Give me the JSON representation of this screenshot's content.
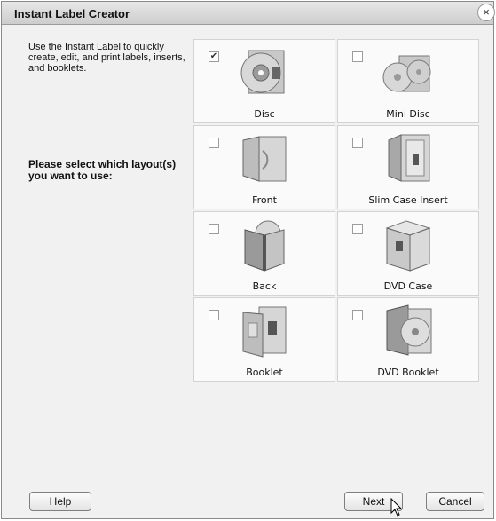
{
  "window": {
    "title": "Instant Label Creator",
    "close_glyph": "×"
  },
  "intro_text": "Use the Instant Label to quickly create, edit, and print labels, inserts, and booklets.",
  "prompt_text": "Please select which layout(s) you want to use:",
  "layouts": [
    {
      "label": "Disc",
      "checked": true,
      "icon": "disc-icon"
    },
    {
      "label": "Mini Disc",
      "checked": false,
      "icon": "mini-disc-icon"
    },
    {
      "label": "Front",
      "checked": false,
      "icon": "front-cover-icon"
    },
    {
      "label": "Slim Case Insert",
      "checked": false,
      "icon": "slim-case-insert-icon"
    },
    {
      "label": "Back",
      "checked": false,
      "icon": "back-cover-icon"
    },
    {
      "label": "DVD Case",
      "checked": false,
      "icon": "dvd-case-icon"
    },
    {
      "label": "Booklet",
      "checked": false,
      "icon": "booklet-icon"
    },
    {
      "label": "DVD Booklet",
      "checked": false,
      "icon": "dvd-booklet-icon"
    }
  ],
  "buttons": {
    "help": "Help",
    "next": "Next",
    "cancel": "Cancel"
  },
  "check_glyph": "✔",
  "colors": {
    "tile_bg": "#fafafa",
    "window_bg": "#f1f1f1",
    "title_bar": "#cdcdcd"
  }
}
